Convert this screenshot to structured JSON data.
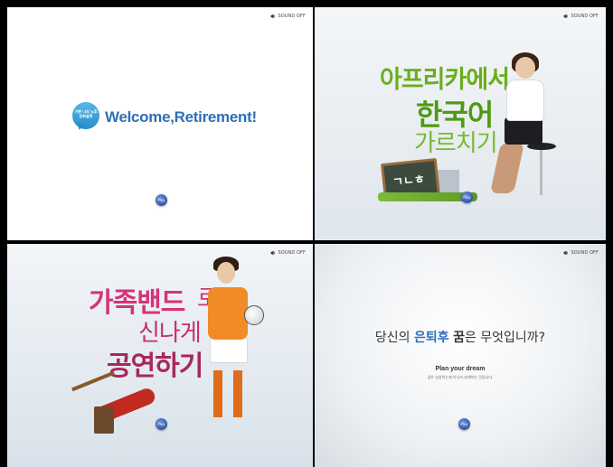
{
  "sound_label": "SOUND OFF",
  "play_label": "Play",
  "panel1": {
    "bubble_text": "기쁜 나의 노후 은퇴설계",
    "welcome": "Welcome,Retirement!"
  },
  "panel2": {
    "line1": "아프리카에서",
    "line2": "한국어",
    "line3": "가르치기",
    "board_text": "ㄱㄴㅎ"
  },
  "panel3": {
    "line1": "가족밴드",
    "line1b": "로",
    "line2": "신나게",
    "line3": "공연하기"
  },
  "panel4": {
    "q_pre": "당신의 ",
    "q_hl": "은퇴후",
    "q_mid": " ",
    "q_strong": "꿈",
    "q_post": "은 무엇입니까?",
    "plan": "Plan your dream",
    "plan_sub": "꿈은 상상하는게 아니라 설계하는 것입니다."
  }
}
